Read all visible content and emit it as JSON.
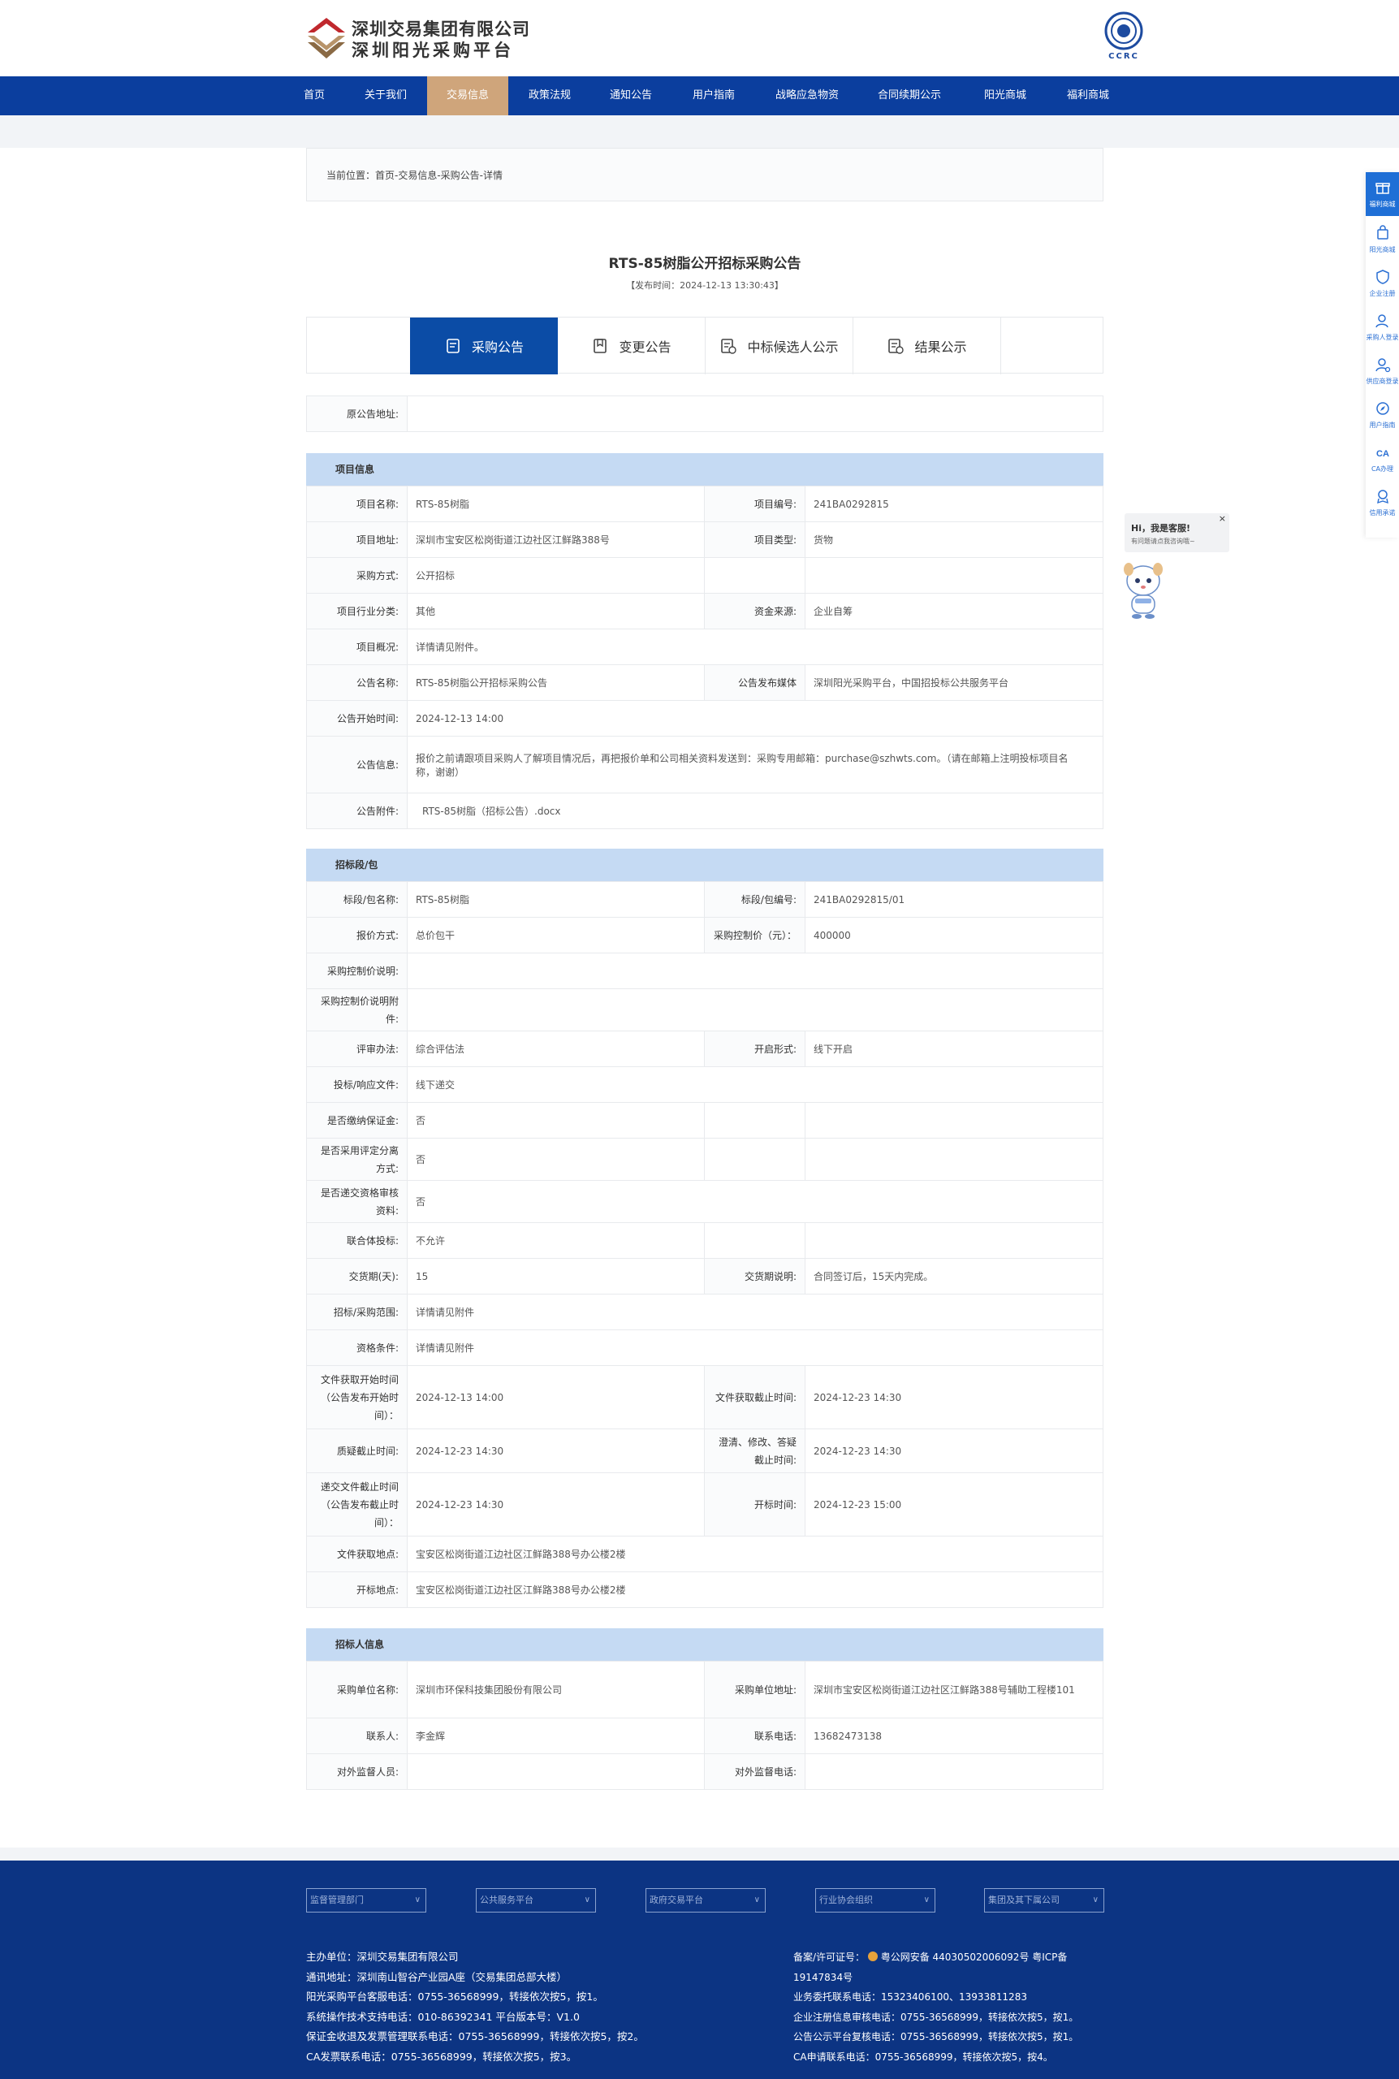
{
  "header": {
    "logo_line1": "深圳交易集团有限公司",
    "logo_line2": "深圳阳光采购平台",
    "cert_text": "CCRC"
  },
  "nav": [
    {
      "label": "首页",
      "active": false
    },
    {
      "label": "关于我们",
      "active": false
    },
    {
      "label": "交易信息",
      "active": true
    },
    {
      "label": "政策法规",
      "active": false
    },
    {
      "label": "通知公告",
      "active": false
    },
    {
      "label": "用户指南",
      "active": false
    },
    {
      "label": "战略应急物资",
      "active": false
    },
    {
      "label": "合同续期公示",
      "active": false
    },
    {
      "label": "阳光商城",
      "active": false
    },
    {
      "label": "福利商城",
      "active": false
    }
  ],
  "breadcrumb": "当前位置：首页-交易信息-采购公告-详情",
  "notice": {
    "title": "RTS-85树脂公开招标采购公告",
    "publish_time": "【发布时间：2024-12-13 13:30:43】"
  },
  "tabs": [
    {
      "label": "采购公告",
      "active": true
    },
    {
      "label": "变更公告",
      "active": false
    },
    {
      "label": "中标候选人公示",
      "active": false
    },
    {
      "label": "结果公示",
      "active": false
    }
  ],
  "source": {
    "label": "原公告地址:",
    "value": ""
  },
  "project_section": {
    "title": "项目信息",
    "name_label": "项目名称:",
    "name_value": "RTS-85树脂",
    "code_label": "项目编号:",
    "code_value": "241BA0292815",
    "addr_label": "项目地址:",
    "addr_value": "深圳市宝安区松岗街道江边社区江鲜路388号",
    "type_label": "项目类型:",
    "type_value": "货物",
    "method_label": "采购方式:",
    "method_value": "公开招标",
    "industry_label": "项目行业分类:",
    "industry_value": "其他",
    "fund_label": "资金来源:",
    "fund_value": "企业自筹",
    "overview_label": "项目概况:",
    "overview_value": "详情请见附件。",
    "notice_name_label": "公告名称:",
    "notice_name_value": "RTS-85树脂公开招标采购公告",
    "media_label": "公告发布媒体",
    "media_value": "深圳阳光采购平台，中国招投标公共服务平台",
    "start_label": "公告开始时间:",
    "start_value": "2024-12-13 14:00",
    "info_label": "公告信息:",
    "info_value": "报价之前请跟项目采购人了解项目情况后，再把报价单和公司相关资料发送到：采购专用邮箱：purchase@szhwts.com。（请在邮箱上注明投标项目名称，谢谢）",
    "attach_label": "公告附件:",
    "attach_value": "RTS-85树脂（招标公告）.docx"
  },
  "bid_section": {
    "title": "招标段/包",
    "pkg_name_label": "标段/包名称:",
    "pkg_name_value": "RTS-85树脂",
    "pkg_code_label": "标段/包编号:",
    "pkg_code_value": "241BA0292815/01",
    "quote_label": "报价方式:",
    "quote_value": "总价包干",
    "ctrl_price_label": "采购控制价（元）：",
    "ctrl_price_value": "400000",
    "ctrl_desc_label": "采购控制价说明:",
    "ctrl_desc_value": "",
    "ctrl_attach_label": "采购控制价说明附件:",
    "ctrl_attach_value": "",
    "eval_label": "评审办法:",
    "eval_value": "综合评估法",
    "open_form_label": "开启形式:",
    "open_form_value": "线下开启",
    "submit_label": "投标/响应文件:",
    "submit_value": "线下递交",
    "deposit_label": "是否缴纳保证金:",
    "deposit_value": "否",
    "separate_label": "是否采用评定分离方式:",
    "separate_value": "否",
    "qualify_label": "是否递交资格审核资料:",
    "qualify_value": "否",
    "consortium_label": "联合体投标:",
    "consortium_value": "不允许",
    "delivery_label": "交货期(天):",
    "delivery_value": "15",
    "delivery_desc_label": "交货期说明:",
    "delivery_desc_value": "合同签订后，15天内完成。",
    "scope_label": "招标/采购范围:",
    "scope_value": "详情请见附件",
    "cond_label": "资格条件:",
    "cond_value": "详情请见附件",
    "file_start_label": "文件获取开始时间（公告发布开始时间）：",
    "file_start_value": "2024-12-13 14:00",
    "file_end_label": "文件获取截止时间:",
    "file_end_value": "2024-12-23 14:30",
    "query_end_label": "质疑截止时间:",
    "query_end_value": "2024-12-23 14:30",
    "clarify_end_label": "澄清、修改、答疑截止时间:",
    "clarify_end_value": "2024-12-23 14:30",
    "deliver_end_label": "递交文件截止时间（公告发布截止时间）：",
    "deliver_end_value": "2024-12-23 14:30",
    "open_time_label": "开标时间:",
    "open_time_value": "2024-12-23 15:00",
    "file_place_label": "文件获取地点:",
    "file_place_value": "宝安区松岗街道江边社区江鲜路388号办公楼2楼",
    "open_place_label": "开标地点:",
    "open_place_value": "宝安区松岗街道江边社区江鲜路388号办公楼2楼"
  },
  "tenderer_section": {
    "title": "招标人信息",
    "unit_label": "采购单位名称:",
    "unit_value": "深圳市环保科技集团股份有限公司",
    "unit_addr_label": "采购单位地址:",
    "unit_addr_value": "深圳市宝安区松岗街道江边社区江鲜路388号辅助工程楼101",
    "contact_label": "联系人:",
    "contact_value": "李金辉",
    "phone_label": "联系电话:",
    "phone_value": "13682473138",
    "supervisor_label": "对外监督人员:",
    "supervisor_value": "",
    "supervisor_phone_label": "对外监督电话:",
    "supervisor_phone_value": ""
  },
  "sidebar": [
    {
      "label": "福利商城",
      "icon": "gift-icon",
      "active": true
    },
    {
      "label": "阳光商城",
      "icon": "bag-icon",
      "active": false
    },
    {
      "label": "企业注册",
      "icon": "shield-icon",
      "active": false
    },
    {
      "label": "采购人登录",
      "icon": "user-icon",
      "active": false
    },
    {
      "label": "供应商登录",
      "icon": "user-gear-icon",
      "active": false
    },
    {
      "label": "用户指南",
      "icon": "compass-icon",
      "active": false
    },
    {
      "label": "CA办理",
      "icon": "ca-icon",
      "active": false
    },
    {
      "label": "信用承诺",
      "icon": "credit-icon",
      "active": false
    }
  ],
  "chat": {
    "greeting": "Hi，我是客服!",
    "sub": "有问题请点我咨询哦~",
    "close": "×"
  },
  "footer": {
    "selects": [
      "监督管理部门",
      "公共服务平台",
      "政府交易平台",
      "行业协会组织",
      "集团及其下属公司"
    ],
    "left_info": [
      "主办单位：深圳交易集团有限公司",
      "通讯地址：深圳南山智谷产业园A座（交易集团总部大楼）",
      "阳光采购平台客服电话：0755-36568999，转接依次按5，按1。",
      "系统操作技术支持电话：010-86392341 平台版本号：V1.0",
      "保证金收退及发票管理联系电话：0755-36568999，转接依次按5，按2。",
      "CA发票联系电话：0755-36568999，转接依次按5，按3。"
    ],
    "right_info": [
      "备案/许可证号：",
      "粤公网安备 44030502006092号 粤ICP备19147834号",
      "业务委托联系电话：15323406100、13933811283",
      "企业注册信息审核电话：0755-36568999，转接依次按5，按1。",
      "公告公示平台复核电话：0755-36568999，转接依次按5，按1。",
      "CA申请联系电话：0755-36568999，转接依次按5，按4。"
    ]
  },
  "colors": {
    "nav_bg": "#0b3e9e",
    "nav_active": "#cfa57b",
    "tab_active": "#0b4ca6",
    "section_bg": "#c5daf3",
    "footer_bg": "#0c3483"
  }
}
